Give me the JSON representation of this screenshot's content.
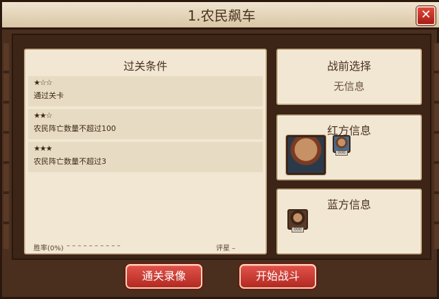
{
  "header": {
    "title": "1.农民飙车",
    "close_label": "✕"
  },
  "conditions_panel": {
    "title": "过关条件",
    "rows": [
      {
        "stars": "★☆☆",
        "text": "通过关卡"
      },
      {
        "stars": "★★☆",
        "text": "农民阵亡数量不超过100"
      },
      {
        "stars": "★★★",
        "text": "农民阵亡数量不超过3"
      }
    ],
    "win_rate": "胜率(0%)",
    "dashes": "– – – – – – – – – –",
    "rating": "评星  –"
  },
  "prebattle_panel": {
    "title": "战前选择",
    "info": "无信息"
  },
  "red_panel": {
    "title": "红方信息",
    "unit_badge": "000"
  },
  "blue_panel": {
    "title": "蓝方信息",
    "unit_badge": "000"
  },
  "buttons": {
    "replay": "通关录像",
    "start": "开始战斗"
  }
}
